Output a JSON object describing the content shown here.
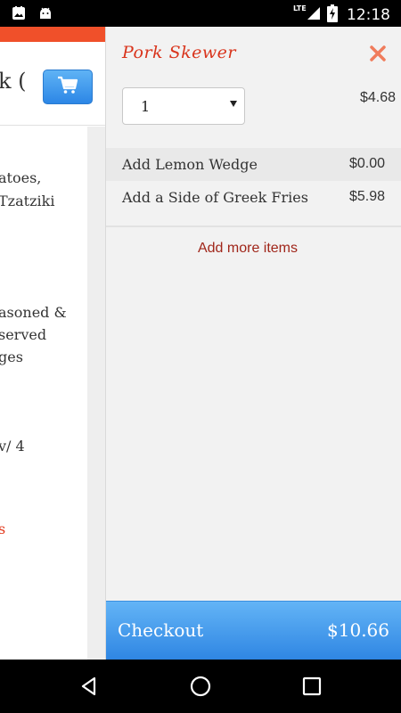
{
  "status_bar": {
    "time": "12:18",
    "network": "LTE"
  },
  "background_page": {
    "header_text": "k (",
    "lines": [
      "atoes,",
      "Tzatziki",
      "asoned &",
      "served",
      "ges",
      "v/ 4",
      "s"
    ]
  },
  "cart": {
    "item_name": "Pork Skewer",
    "quantity": "1",
    "base_price": "$4.68",
    "options": [
      {
        "label": "Add Lemon Wedge",
        "price": "$0.00"
      },
      {
        "label": "Add a Side of Greek Fries",
        "price": "$5.98"
      }
    ],
    "add_more_label": "Add more items",
    "checkout_label": "Checkout",
    "total": "$10.66"
  },
  "colors": {
    "accent_orange": "#f0502a",
    "item_title": "#d9341c",
    "close_icon": "#f07c5c",
    "link": "#a0261a",
    "checkout_blue": "#3a8fe0"
  },
  "icons": [
    "image-icon",
    "android-icon",
    "signal-icon",
    "battery-charging-icon",
    "cart-icon",
    "close-icon",
    "back-icon",
    "home-icon",
    "recents-icon"
  ]
}
